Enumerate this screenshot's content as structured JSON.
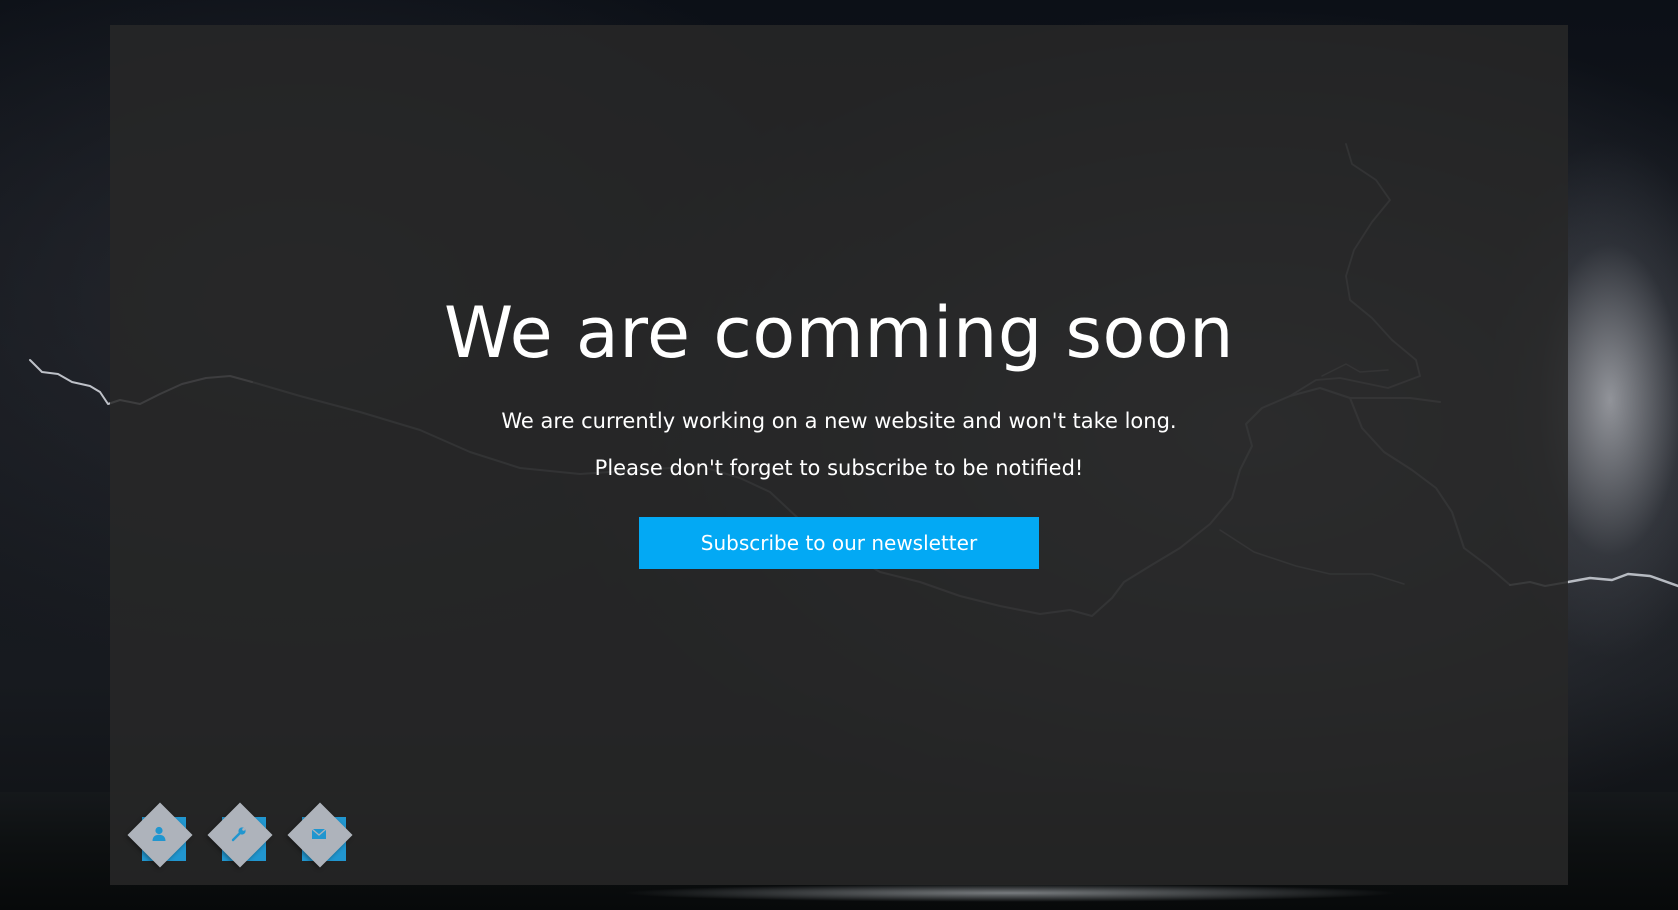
{
  "hero": {
    "title": "We are comming soon",
    "line1": "We are currently working on a new website and won't take long.",
    "line2": "Please don't forget to subscribe to be notified!",
    "subscribe_label": "Subscribe to our newsletter"
  },
  "social_links": [
    {
      "icon": "user-icon"
    },
    {
      "icon": "wrench-icon"
    },
    {
      "icon": "envelope-icon"
    }
  ],
  "colors": {
    "accent": "#03a9f4",
    "panel": "#282828",
    "text": "#ffffff",
    "diamond": "#aeb3bb",
    "diamond_shadow_square": "#2196cf"
  }
}
